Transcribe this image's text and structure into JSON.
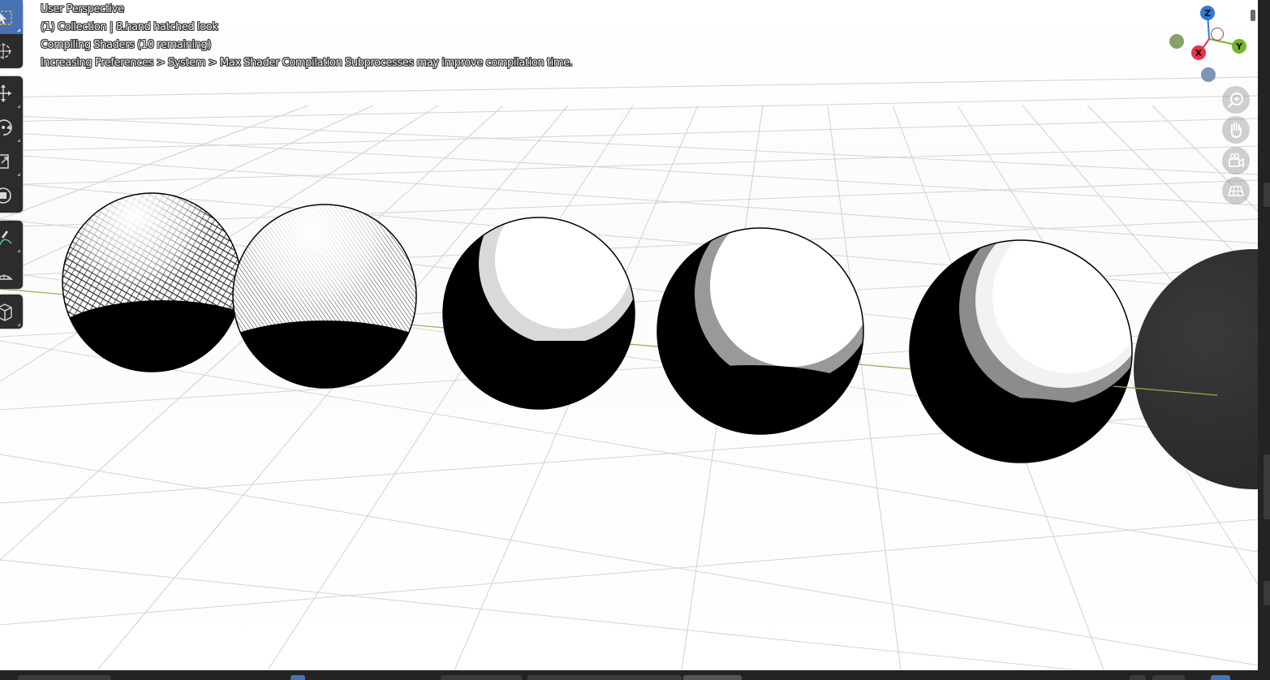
{
  "viewport": {
    "overlay": {
      "perspective": "User Perspective",
      "collection_line": "(1) Collection | 8.hand hatched look",
      "status": "Compiling Shaders (10 remaining)",
      "hint": "Increasing Preferences > System > Max Shader Compilation Subprocesses may improve compilation time."
    }
  },
  "gizmo": {
    "z_label": "Z",
    "y_label": "Y",
    "x_label": "X",
    "colors": {
      "x": "#e5334a",
      "y": "#76b52a",
      "z": "#2f7ad6",
      "neg": "#8aa06a",
      "neg_z": "#7f93b5"
    }
  },
  "toolbar": {
    "tools": [
      "select-box",
      "cursor",
      "move",
      "rotate",
      "scale",
      "transform",
      "annotate",
      "measure",
      "add-cube"
    ]
  },
  "navigation": [
    "zoom-icon",
    "hand-pan-icon",
    "camera-icon",
    "grid-ortho-icon"
  ],
  "scene": {
    "spheres": [
      "hatched-crosshatch",
      "hatched-fine",
      "stippled",
      "dotted-bands",
      "halftone",
      "dark-partial"
    ],
    "colors": {
      "grid": "#d6d6d6",
      "axis_line": "#8fb05a",
      "background": "#ffffff"
    }
  }
}
